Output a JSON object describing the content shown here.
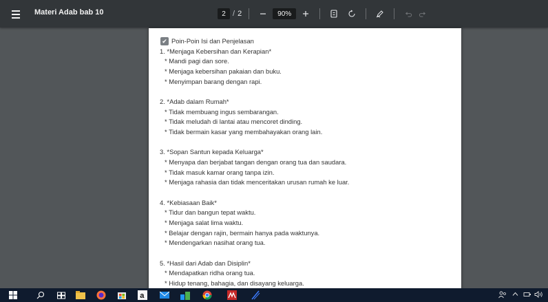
{
  "toolbar": {
    "title": "Materi Adab bab 10",
    "current_page": "2",
    "page_separator": "/",
    "total_pages": "2",
    "zoom": "90%"
  },
  "document": {
    "heading": "Poin-Poin Isi dan Penjelasan",
    "sections": [
      {
        "title": "1. *Menjaga Kebersihan dan Kerapian*",
        "items": [
          "* Mandi pagi dan sore.",
          "* Menjaga kebersihan pakaian dan buku.",
          "* Menyimpan barang dengan rapi."
        ]
      },
      {
        "title": "2. *Adab dalam Rumah*",
        "items": [
          "* Tidak membuang ingus sembarangan.",
          "* Tidak meludah di lantai atau mencoret dinding.",
          "* Tidak bermain kasar yang membahayakan orang lain."
        ]
      },
      {
        "title": "3. *Sopan Santun kepada Keluarga*",
        "items": [
          "* Menyapa dan berjabat tangan dengan orang tua dan saudara.",
          "* Tidak masuk kamar orang tanpa izin.",
          "* Menjaga rahasia dan tidak menceritakan urusan rumah ke luar."
        ]
      },
      {
        "title": "4. *Kebiasaan Baik*",
        "items": [
          "* Tidur dan bangun tepat waktu.",
          "* Menjaga salat lima waktu.",
          "* Belajar dengan rajin, bermain hanya pada waktunya.",
          "* Mendengarkan nasihat orang tua."
        ]
      },
      {
        "title": "5. *Hasil dari Adab dan Disiplin*",
        "items": [
          "* Mendapatkan ridha orang tua.",
          "* Hidup tenang, bahagia, dan disayang keluarga."
        ]
      }
    ]
  },
  "icons": {
    "menu": "hamburger-icon",
    "zoom_out": "minus-icon",
    "zoom_in": "plus-icon",
    "fit": "fit-page-icon",
    "rotate": "rotate-icon",
    "annotate": "pen-icon",
    "undo": "undo-icon",
    "redo": "redo-icon"
  },
  "colors": {
    "toolbar_bg": "#323639",
    "viewer_bg": "#525659",
    "page_bg": "#ffffff",
    "taskbar_bg": "#0f1b2e"
  }
}
